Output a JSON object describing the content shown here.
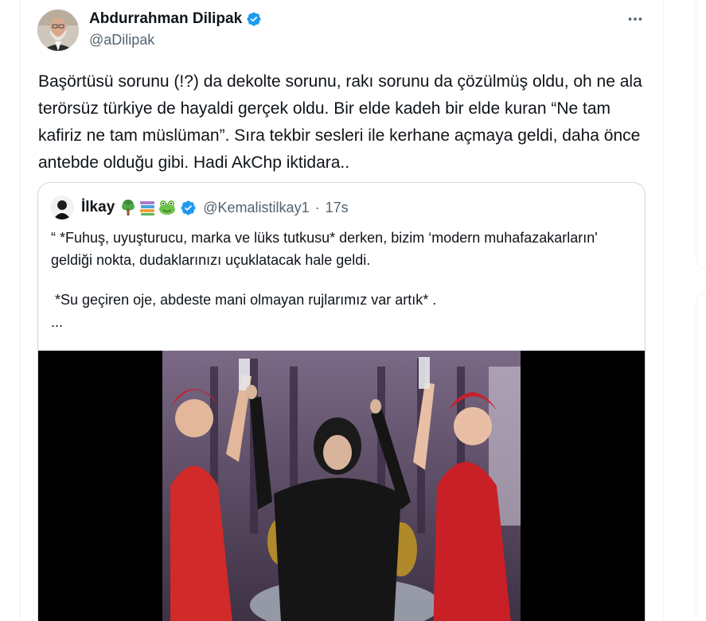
{
  "author": {
    "name": "Abdurrahman Dilipak",
    "handle": "@aDilipak",
    "verified": true
  },
  "tweet": {
    "text": "Başörtüsü sorunu (!?) da dekolte sorunu, rakı sorunu da çözülmüş oldu, oh ne ala terörsüz türkiye de hayaldi gerçek oldu. Bir elde kadeh bir elde kuran “Ne tam kafiriz ne tam müslüman”. Sıra tekbir sesleri ile kerhane açmaya geldi, daha önce antebde olduğu gibi. Hadi AkChp iktidara.."
  },
  "more_icon": "more-horizontal-icon",
  "quote": {
    "name": "İlkay",
    "emojis": [
      "deciduous-tree-icon",
      "books-icon",
      "frog-icon"
    ],
    "verified": true,
    "handle": "@Kemalistilkay1",
    "separator": "·",
    "time": "17s",
    "lines": [
      "“ *Fuhuş, uyuşturucu, marka ve lüks tutkusu* derken, bizim ‘modern muhafazakarların' geldiği nokta, dudaklarınızı uçuklatacak hale geldi.",
      " *Su geçiren oje, abdeste mani olmayan rujlarımız var artık* .",
      "..."
    ]
  },
  "colors": {
    "text_primary": "#0f1419",
    "text_secondary": "#536471",
    "verified_blue": "#1d9bf0",
    "border": "#cfd9de"
  }
}
